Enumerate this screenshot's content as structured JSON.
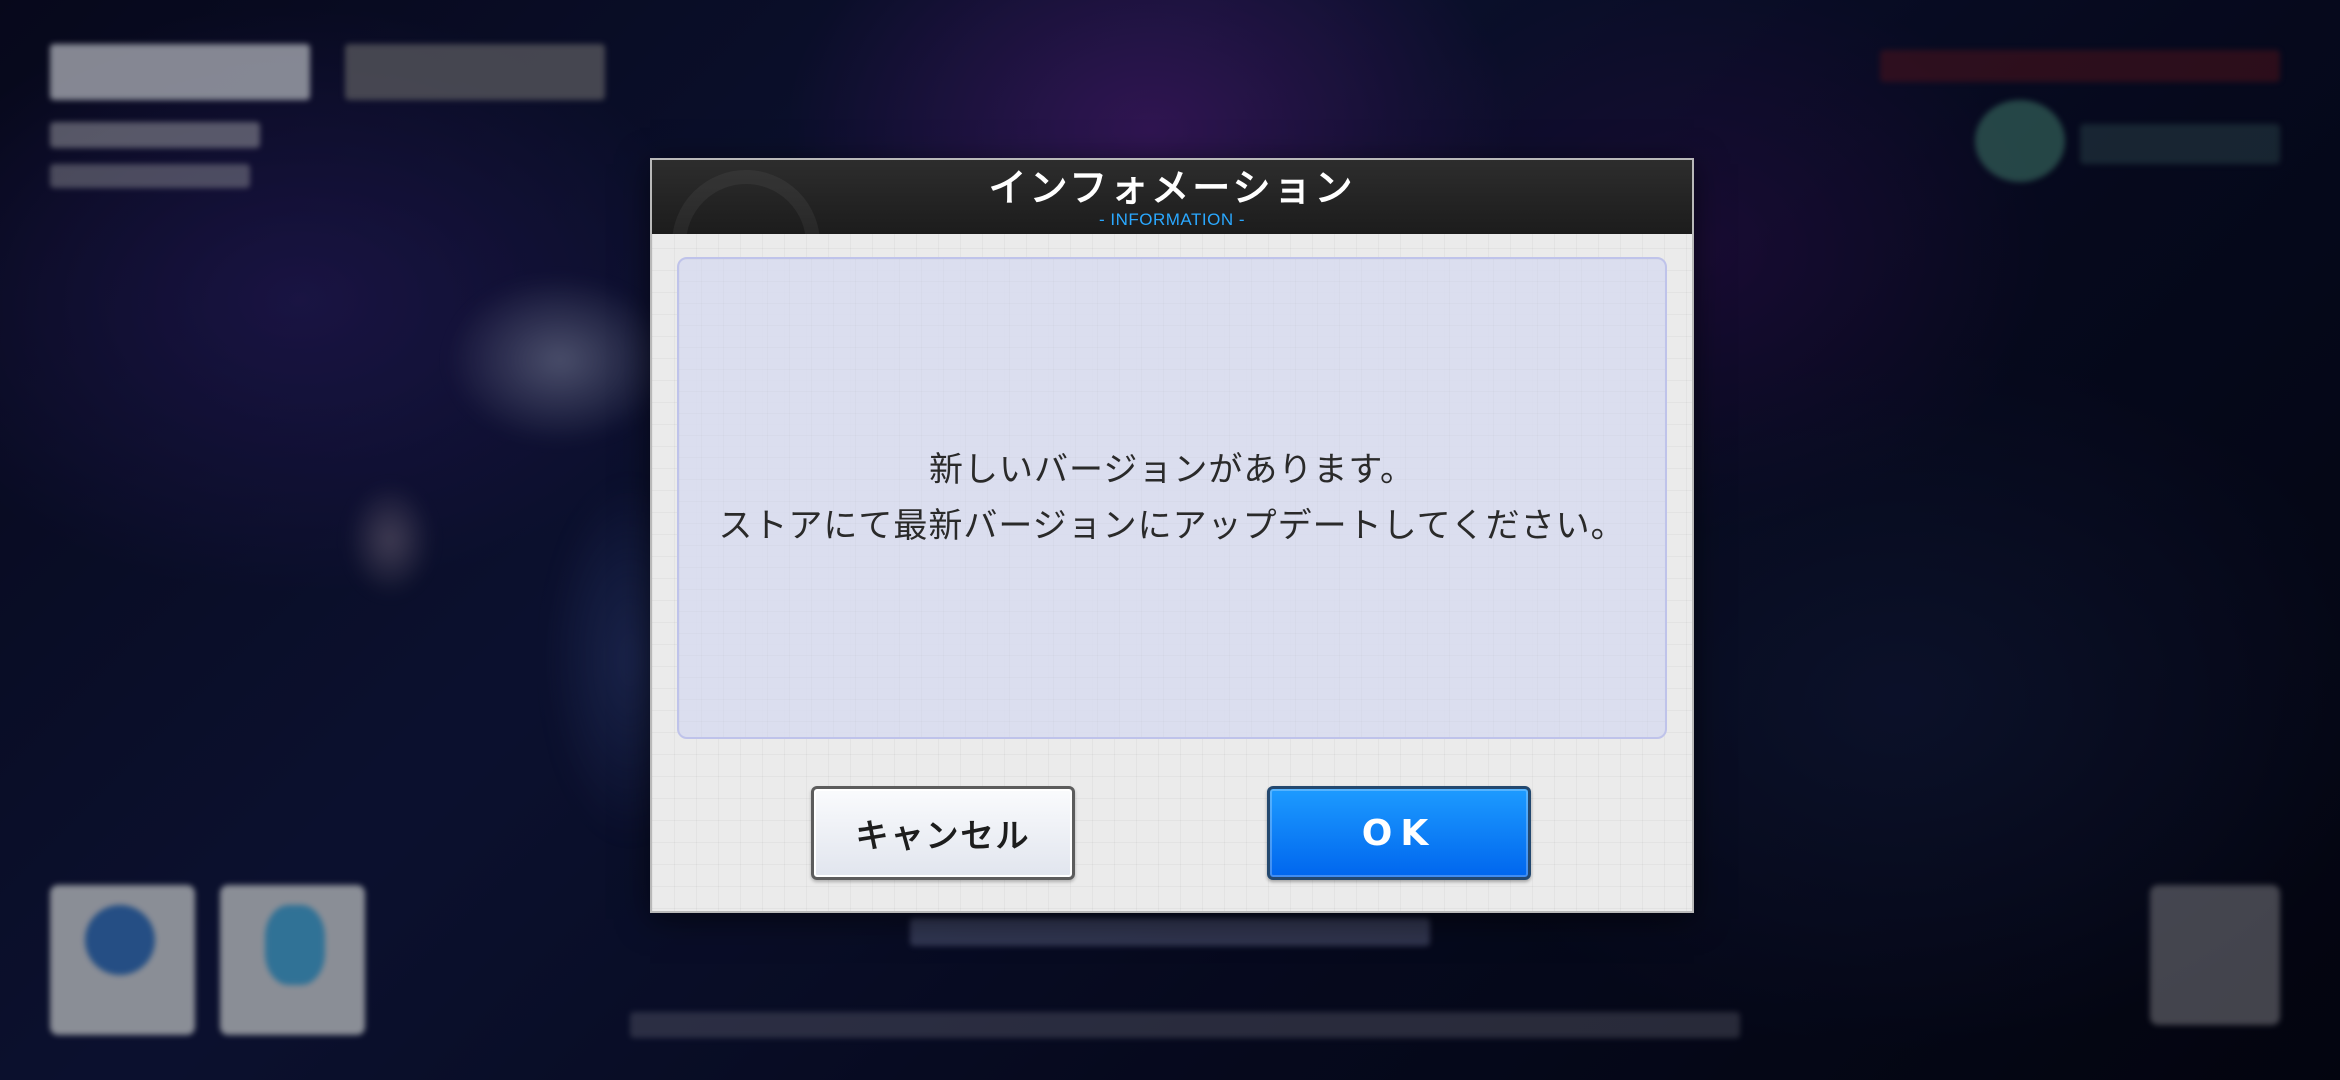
{
  "dialog": {
    "title": "インフォメーション",
    "subtitle": "- INFORMATION -",
    "message_lines": [
      "新しいバージョンがあります。",
      "ストアにて最新バージョンにアップデートしてください。"
    ],
    "cancel_label": "キャンセル",
    "ok_label": "OK"
  },
  "colors": {
    "accent_blue": "#0a7ff5",
    "subtitle_blue": "#2aa8ff",
    "header_bg": "#222222"
  }
}
